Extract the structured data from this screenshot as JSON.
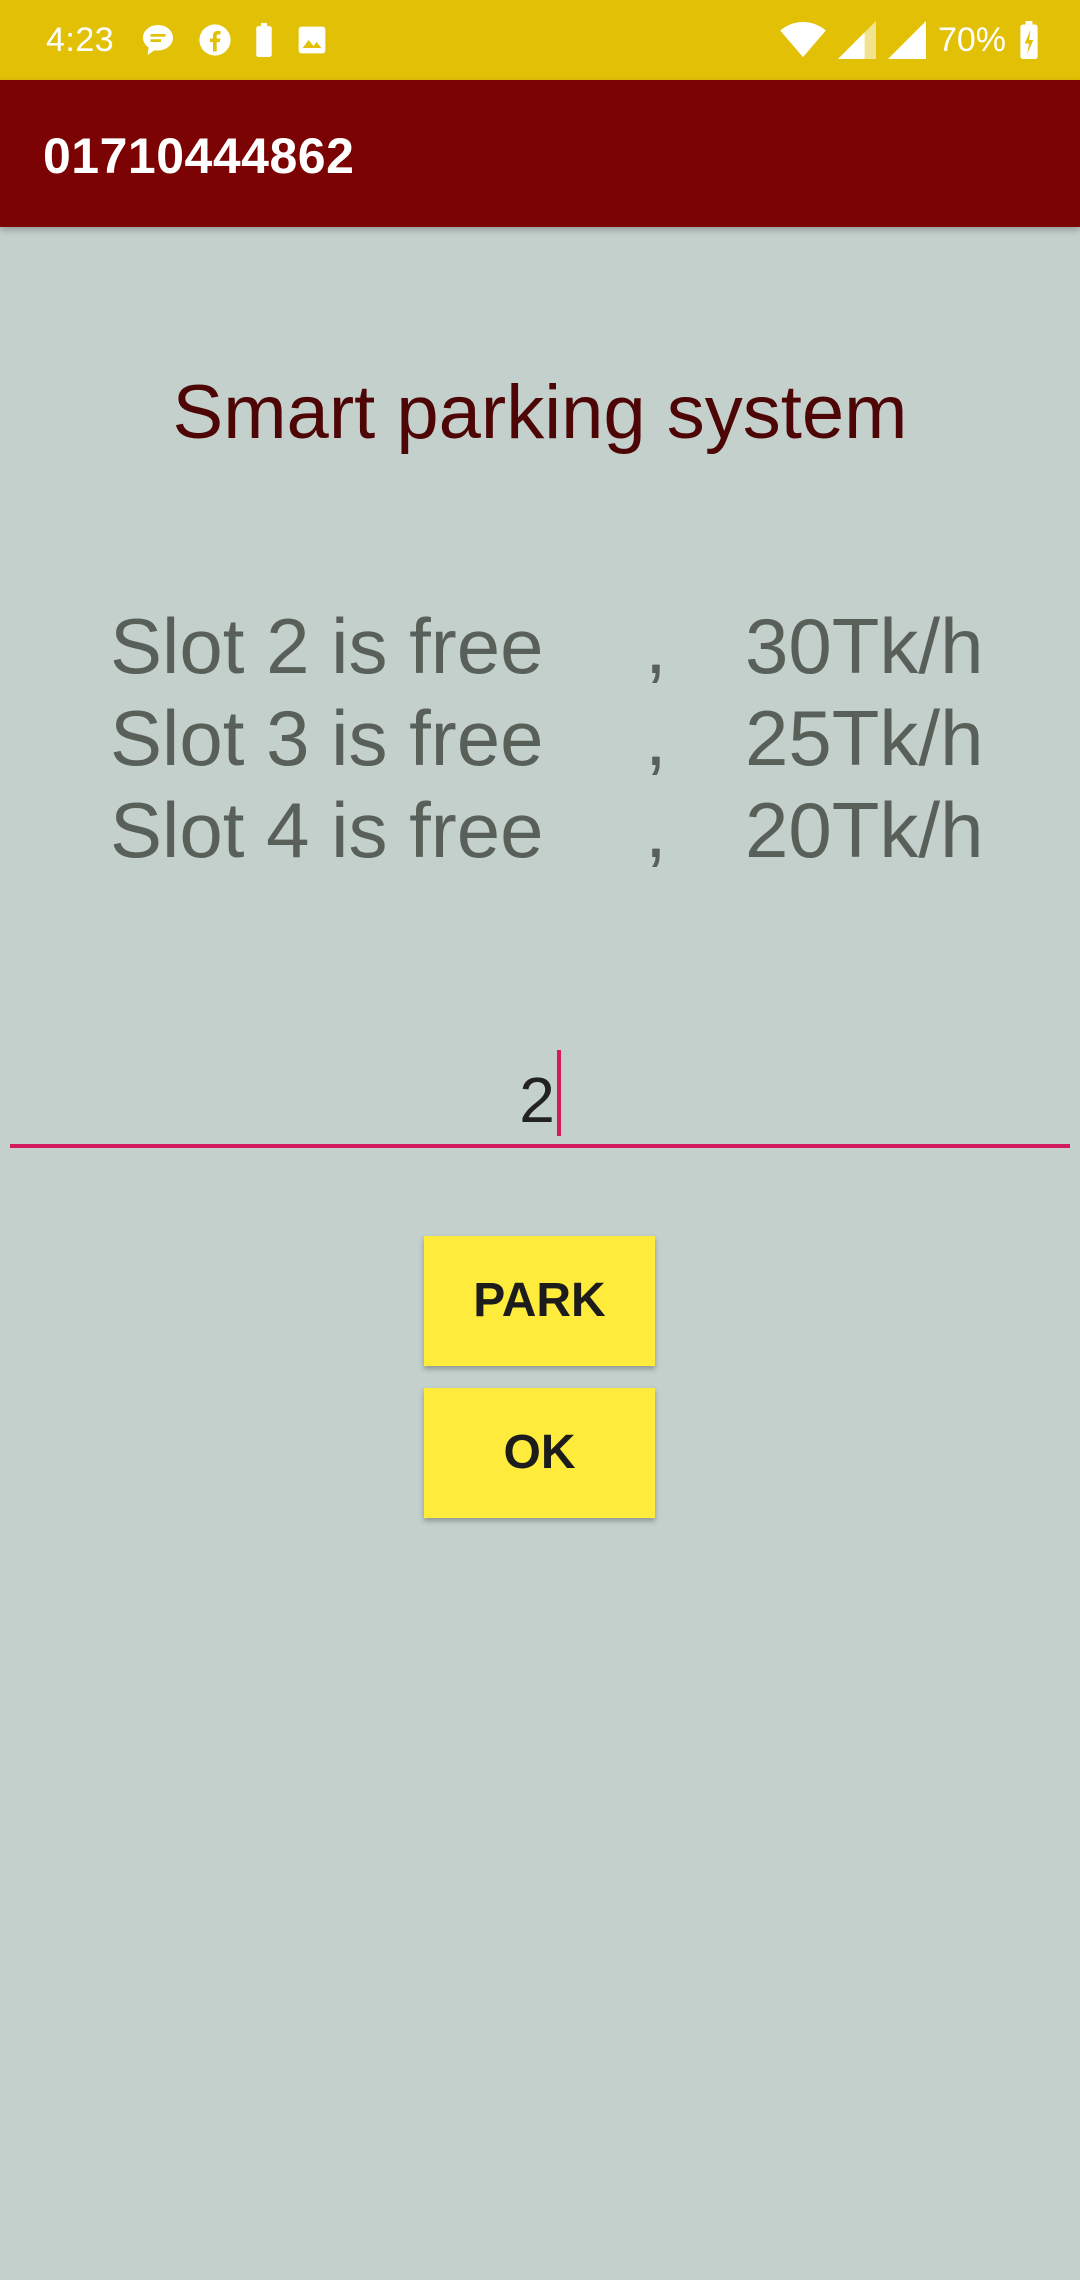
{
  "status_bar": {
    "time": "4:23",
    "battery_percent": "70%",
    "icons_left": [
      "message-icon",
      "facebook-icon",
      "battery-saver-icon",
      "image-icon"
    ],
    "icons_right": [
      "wifi-icon",
      "signal-icon",
      "signal-icon",
      "battery-charging-icon"
    ],
    "color": "#e2c006"
  },
  "app_bar": {
    "title": "01710444862",
    "color": "#7b0303"
  },
  "main": {
    "headline": "Smart parking system",
    "slots": [
      {
        "text": "Slot 2 is free",
        "separator": ",",
        "price": "30Tk/h"
      },
      {
        "text": "Slot 3 is free",
        "separator": ",",
        "price": "25Tk/h"
      },
      {
        "text": "Slot 4 is free",
        "separator": ",",
        "price": "20Tk/h"
      }
    ],
    "slot_input": {
      "value": "2",
      "accent_color": "#d31b5f"
    },
    "park_button": "PARK",
    "ok_button": "OK",
    "button_color": "#ffeb3b",
    "background": "#c3d0cc"
  }
}
